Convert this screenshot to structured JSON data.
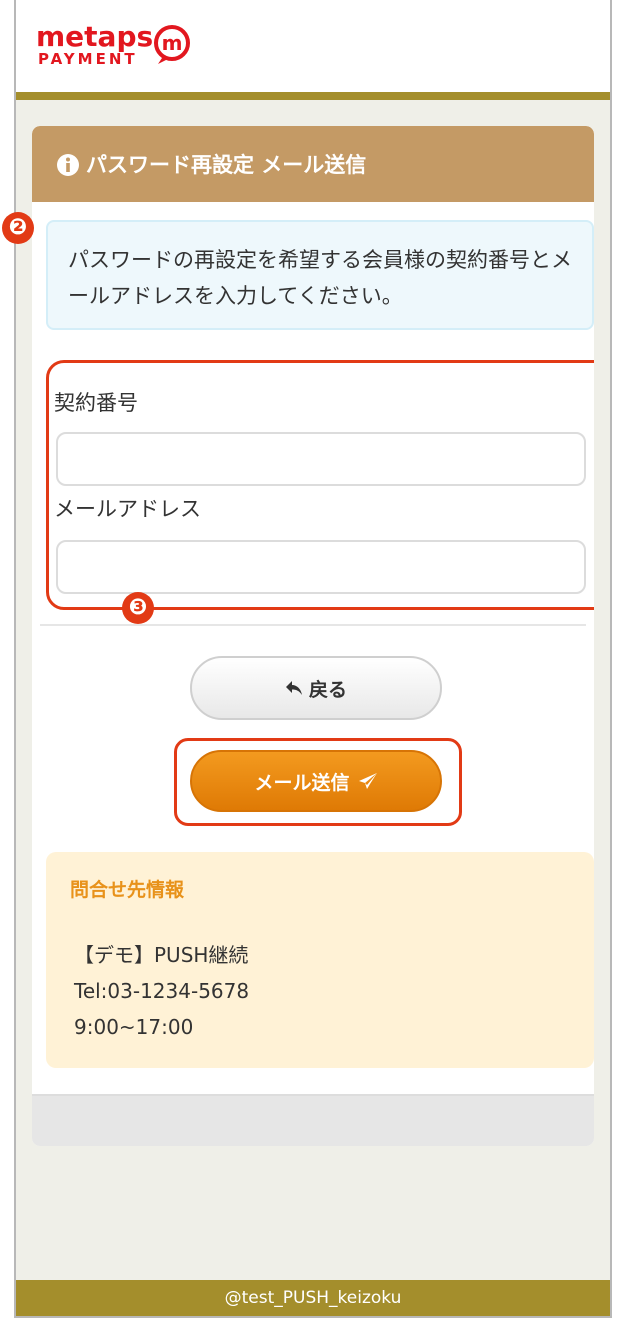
{
  "header": {
    "logo_text": "metaps",
    "logo_sub": "PAYMENT",
    "logo_colors": {
      "brand": "#e2171f",
      "accent_bar": "#a48e2c"
    }
  },
  "panel": {
    "title": "パスワード再設定 メール送信",
    "title_icon": "info-circle-icon",
    "info_text": "パスワードの再設定を希望する会員様の契約番号とメールアドレスを入力してください。",
    "header_color": "#c49a65"
  },
  "annotations": {
    "badge_2": "❷",
    "badge_3": "❸",
    "color": "#e23a15"
  },
  "form": {
    "contract_label": "契約番号",
    "contract_value": "",
    "email_label": "メールアドレス",
    "email_value": ""
  },
  "buttons": {
    "back_label": "戻る",
    "back_icon": "reply-arrow-icon",
    "send_label": "メール送信",
    "send_icon": "paper-plane-icon",
    "send_color": "#ef8d14"
  },
  "contact": {
    "title": "問合せ先情報",
    "lines": [
      "【デモ】PUSH継続",
      "Tel:03-1234-5678",
      "9:00~17:00"
    ]
  },
  "footer": {
    "text": "@test_PUSH_keizoku"
  }
}
